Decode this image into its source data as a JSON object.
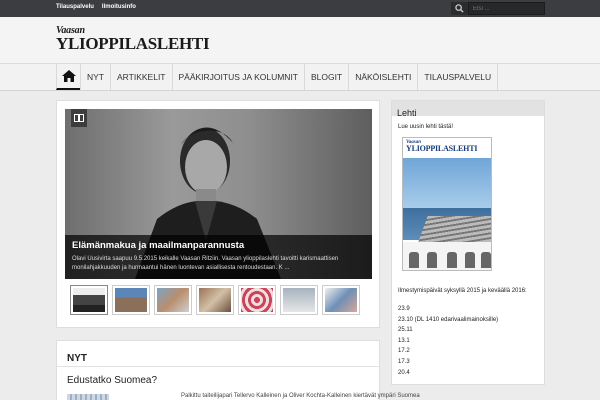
{
  "topbar": {
    "links": [
      "Tilauspalvelu",
      "Ilmoitusinfo"
    ],
    "search_placeholder": "Etsi ..."
  },
  "header": {
    "logo_line1": "Vaasan",
    "logo_line2": "YLIOPPILASLEHTI"
  },
  "nav": {
    "items": [
      "NYT",
      "ARTIKKELIT",
      "PÄÄKIRJOITUS JA KOLUMNIT",
      "BLOGIT",
      "NÄKÖISLEHTI",
      "TILAUSPALVELU"
    ]
  },
  "featured": {
    "title": "Elämänmakua ja maailmanparannusta",
    "excerpt": "Olavi Uusivirta saapuu 9.5.2015 keikalle Vaasan Ritziin. Vaasan ylioppilaslehti tavoitti karismaattisen monilahjakkuuden ja hurmaantui hänen luontevan asiallisesta rentoudestaan. K ..."
  },
  "nyt": {
    "heading": "NYT",
    "post_title": "Edustatko Suomea?",
    "post_excerpt": "Palkittu taiteilijapari Tellervo Kalleinen ja Oliver Kochta-Kalleinen kiertävät ympäri Suomea"
  },
  "sidebar": {
    "heading": "Lehti",
    "intro": "Lue uusin lehti tästä!",
    "cover_line1": "Vaasan",
    "cover_line2": "YLIOPPILASLEHTI",
    "schedule_title": "Ilmestymispäivät syksyllä 2015 ja keväällä 2016:",
    "dates": [
      "23.9",
      "23.10 (DL 1410 edarivaalimainoksille)",
      "25.11",
      "13.1",
      "17.2",
      "17.3",
      "20.4"
    ]
  },
  "colors": {
    "topbar": "#3b3d40",
    "background": "#ececec",
    "panel": "#ffffff",
    "cover_blue": "#143a7a"
  }
}
